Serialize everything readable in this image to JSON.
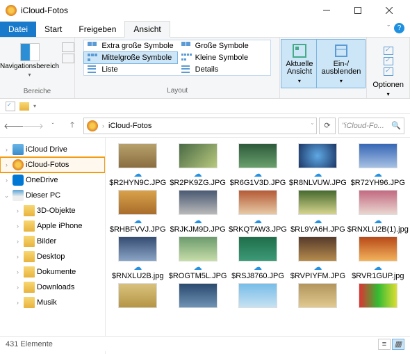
{
  "window": {
    "title": "iCloud-Fotos"
  },
  "tabs": {
    "file": "Datei",
    "start": "Start",
    "share": "Freigeben",
    "view": "Ansicht"
  },
  "ribbon": {
    "navpane": "Navigationsbereich",
    "group_panes": "Bereiche",
    "group_layout": "Layout",
    "layouts": {
      "xl": "Extra große Symbole",
      "lg": "Große Symbole",
      "md": "Mittelgroße Symbole",
      "sm": "Kleine Symbole",
      "list": "Liste",
      "det": "Details"
    },
    "curview": "Aktuelle\nAnsicht",
    "showhide": "Ein-/\nausblenden",
    "options": "Optionen"
  },
  "address": {
    "path": "iCloud-Fotos"
  },
  "search": {
    "placeholder": "\"iCloud-Fo..."
  },
  "tree": [
    {
      "label": "iCloud Drive",
      "icon": "drive",
      "level": 1,
      "exp": ">"
    },
    {
      "label": "iCloud-Fotos",
      "icon": "cloud",
      "level": 1,
      "exp": ">",
      "sel": true
    },
    {
      "label": "OneDrive",
      "icon": "od",
      "level": 1,
      "exp": ">"
    },
    {
      "label": "Dieser PC",
      "icon": "pc",
      "level": 1,
      "exp": "v"
    },
    {
      "label": "3D-Objekte",
      "icon": "fold",
      "level": 2,
      "exp": ">"
    },
    {
      "label": "Apple iPhone",
      "icon": "fold",
      "level": 2,
      "exp": ">"
    },
    {
      "label": "Bilder",
      "icon": "fold",
      "level": 2,
      "exp": ">"
    },
    {
      "label": "Desktop",
      "icon": "fold",
      "level": 2,
      "exp": ">"
    },
    {
      "label": "Dokumente",
      "icon": "fold",
      "level": 2,
      "exp": ">"
    },
    {
      "label": "Downloads",
      "icon": "fold",
      "level": 2,
      "exp": ">"
    },
    {
      "label": "Musik",
      "icon": "fold",
      "level": 2,
      "exp": ">"
    }
  ],
  "files": [
    {
      "name": "$R2HYN9C.JPG",
      "t": "t1"
    },
    {
      "name": "$R2PK9ZG.JPG",
      "t": "t2"
    },
    {
      "name": "$R6G1V3D.JPG",
      "t": "t3"
    },
    {
      "name": "$R8NLVUW.JPG",
      "t": "t4"
    },
    {
      "name": "$R72YH96.JPG",
      "t": "t5"
    },
    {
      "name": "$RHBFVVJ.JPG",
      "t": "t6"
    },
    {
      "name": "$RJKJM9D.JPG",
      "t": "t7"
    },
    {
      "name": "$RKQTAW3.JPG",
      "t": "t8"
    },
    {
      "name": "$RL9YA6H.JPG",
      "t": "t9"
    },
    {
      "name": "$RNXLU2B(1).jpg",
      "t": "t10"
    },
    {
      "name": "$RNXLU2B.jpg",
      "t": "t11"
    },
    {
      "name": "$ROGTM5L.JPG",
      "t": "t12"
    },
    {
      "name": "$RSJ8760.JPG",
      "t": "t13"
    },
    {
      "name": "$RVPIYFM.JPG",
      "t": "t14"
    },
    {
      "name": "$RVR1GUP.jpg",
      "t": "t15"
    },
    {
      "name": "",
      "t": "t16"
    },
    {
      "name": "",
      "t": "t17"
    },
    {
      "name": "",
      "t": "t18"
    },
    {
      "name": "",
      "t": "t19"
    },
    {
      "name": "",
      "t": "t20"
    }
  ],
  "status": {
    "count": "431 Elemente"
  }
}
